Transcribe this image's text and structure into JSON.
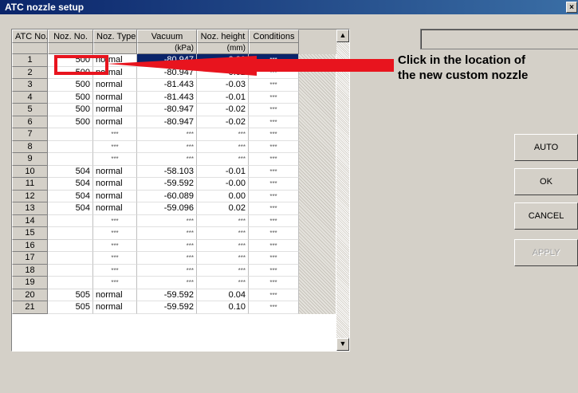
{
  "window": {
    "title": "ATC nozzle setup",
    "close_glyph": "×"
  },
  "table": {
    "headers": [
      "ATC No.",
      "Noz. No.",
      "Noz. Type",
      "Vacuum",
      "Noz. height",
      "Conditions"
    ],
    "units": [
      "",
      "",
      "",
      "(kPa)",
      "(mm)",
      ""
    ],
    "rows": [
      {
        "atc": "1",
        "noz": "500",
        "type": "normal",
        "vac": "-80.947",
        "h": "0.00",
        "cond": "***"
      },
      {
        "atc": "2",
        "noz": "500",
        "type": "normal",
        "vac": "-80.947",
        "h": "-0.02",
        "cond": "***"
      },
      {
        "atc": "3",
        "noz": "500",
        "type": "normal",
        "vac": "-81.443",
        "h": "-0.03",
        "cond": "***"
      },
      {
        "atc": "4",
        "noz": "500",
        "type": "normal",
        "vac": "-81.443",
        "h": "-0.01",
        "cond": "***"
      },
      {
        "atc": "5",
        "noz": "500",
        "type": "normal",
        "vac": "-80.947",
        "h": "-0.02",
        "cond": "***"
      },
      {
        "atc": "6",
        "noz": "500",
        "type": "normal",
        "vac": "-80.947",
        "h": "-0.02",
        "cond": "***"
      },
      {
        "atc": "7",
        "noz": "",
        "type": "***",
        "vac": "***",
        "h": "***",
        "cond": "***"
      },
      {
        "atc": "8",
        "noz": "",
        "type": "***",
        "vac": "***",
        "h": "***",
        "cond": "***"
      },
      {
        "atc": "9",
        "noz": "",
        "type": "***",
        "vac": "***",
        "h": "***",
        "cond": "***"
      },
      {
        "atc": "10",
        "noz": "504",
        "type": "normal",
        "vac": "-58.103",
        "h": "-0.01",
        "cond": "***"
      },
      {
        "atc": "11",
        "noz": "504",
        "type": "normal",
        "vac": "-59.592",
        "h": "-0.00",
        "cond": "***"
      },
      {
        "atc": "12",
        "noz": "504",
        "type": "normal",
        "vac": "-60.089",
        "h": "0.00",
        "cond": "***"
      },
      {
        "atc": "13",
        "noz": "504",
        "type": "normal",
        "vac": "-59.096",
        "h": "0.02",
        "cond": "***"
      },
      {
        "atc": "14",
        "noz": "",
        "type": "***",
        "vac": "***",
        "h": "***",
        "cond": "***"
      },
      {
        "atc": "15",
        "noz": "",
        "type": "***",
        "vac": "***",
        "h": "***",
        "cond": "***"
      },
      {
        "atc": "16",
        "noz": "",
        "type": "***",
        "vac": "***",
        "h": "***",
        "cond": "***"
      },
      {
        "atc": "17",
        "noz": "",
        "type": "***",
        "vac": "***",
        "h": "***",
        "cond": "***"
      },
      {
        "atc": "18",
        "noz": "",
        "type": "***",
        "vac": "***",
        "h": "***",
        "cond": "***"
      },
      {
        "atc": "19",
        "noz": "",
        "type": "***",
        "vac": "***",
        "h": "***",
        "cond": "***"
      },
      {
        "atc": "20",
        "noz": "505",
        "type": "normal",
        "vac": "-59.592",
        "h": "0.04",
        "cond": "***"
      },
      {
        "atc": "21",
        "noz": "505",
        "type": "normal",
        "vac": "-59.592",
        "h": "0.10",
        "cond": "***"
      }
    ]
  },
  "buttons": {
    "auto": "AUTO",
    "ok": "OK",
    "cancel": "CANCEL",
    "apply": "APPLY"
  },
  "scrollbar": {
    "up_glyph": "▲",
    "down_glyph": "▼"
  },
  "annotation": {
    "line1": "Click in the location of",
    "line2": "the new custom nozzle",
    "color": "#e8141e"
  }
}
